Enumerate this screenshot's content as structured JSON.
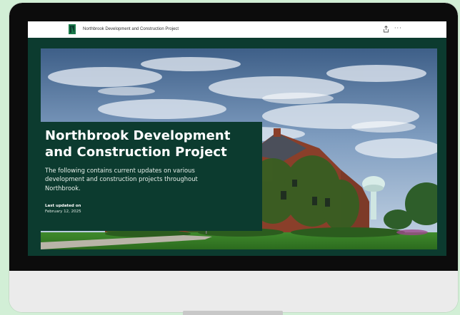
{
  "header": {
    "brand_title": "Northbrook Development and Construction Project",
    "icons": [
      "logo-icon",
      "share-icon",
      "more-icon"
    ],
    "more_glyph": "···"
  },
  "hero": {
    "title": "Northbrook Development and Construction Project",
    "description": "The following contains current updates on various development and construction projects throughout Northbrook.",
    "updated_label": "Last updated on",
    "updated_date": "February 12, 2025"
  },
  "colors": {
    "page_background": "#d2efd6",
    "bezel": "#0c0c0c",
    "brand_green": "#0c3b2f",
    "logo_green": "#1a7a4a"
  }
}
